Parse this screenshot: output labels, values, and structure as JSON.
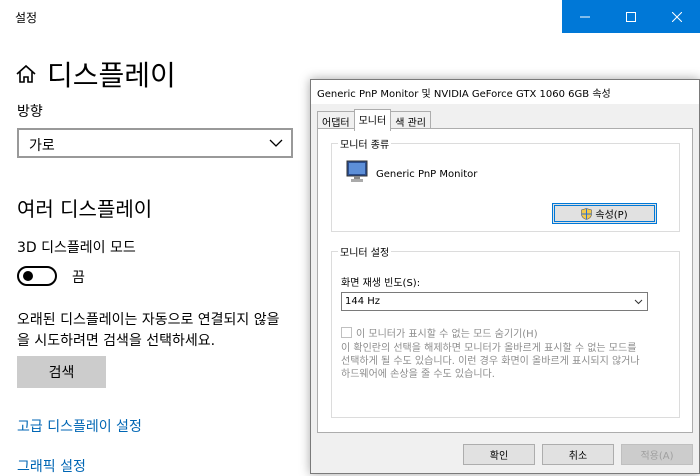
{
  "settings": {
    "window_title": "설정",
    "page_title": "디스플레이",
    "orientation_label": "방향",
    "orientation_value": "가로",
    "multi_display_heading": "여러 디스플레이",
    "mode_3d_label": "3D 디스플레이 모드",
    "toggle_state": "끔",
    "description": "오래된 디스플레이는 자동으로 연결되지 않을\n을 시도하려면 검색을 선택하세요.",
    "search_button": "검색",
    "advanced_link": "고급 디스플레이 설정",
    "graphics_link": "그래픽 설정"
  },
  "dialog": {
    "title": "Generic PnP Monitor 및 NVIDIA GeForce GTX 1060 6GB 속성",
    "tabs": [
      {
        "label": "어댑터"
      },
      {
        "label": "모니터"
      },
      {
        "label": "색 관리"
      }
    ],
    "monitor_type_group": "모니터 종류",
    "monitor_name": "Generic PnP Monitor",
    "properties_button": "속성(P)",
    "monitor_settings_group": "모니터 설정",
    "refresh_rate_label": "화면 재생 빈도(S):",
    "refresh_rate_value": "144 Hz",
    "hide_modes_checkbox": "이 모니터가 표시할 수 없는 모드 숨기기(H)",
    "hide_modes_checked": false,
    "warning_text": "이 확인란의 선택을 해제하면 모니터가 올바르게 표시할 수 없는 모드를\n선택하게 될 수도 있습니다. 이런 경우 화면이 올바르게 표시되지 않거나\n하드웨어에 손상을 줄 수도 있습니다.",
    "ok_button": "확인",
    "cancel_button": "취소",
    "apply_button": "적용(A)"
  },
  "colors": {
    "accent": "#0078d7",
    "link": "#0066b4"
  }
}
